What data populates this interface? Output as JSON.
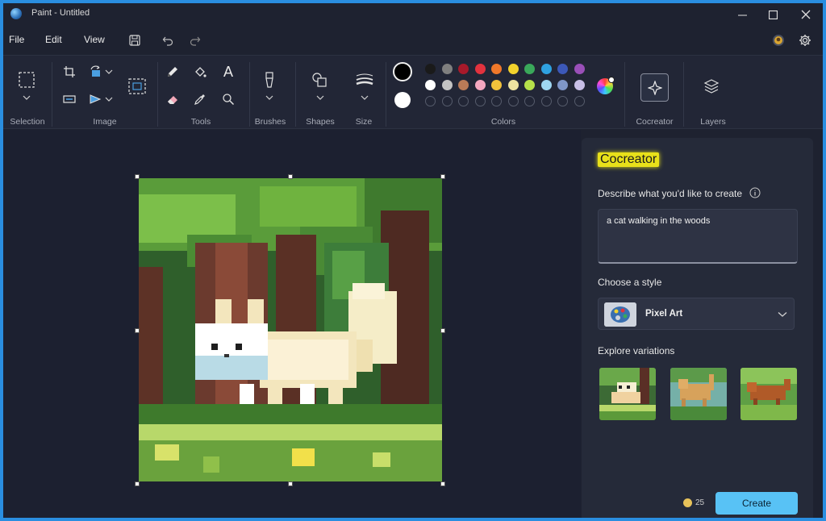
{
  "window": {
    "title": "Paint - Untitled"
  },
  "menubar": {
    "items": [
      "File",
      "Edit",
      "View"
    ]
  },
  "ribbon": {
    "groups": {
      "selection": "Selection",
      "image": "Image",
      "tools": "Tools",
      "brushes": "Brushes",
      "shapes": "Shapes",
      "size": "Size",
      "colors": "Colors",
      "cocreator": "Cocreator",
      "layers": "Layers"
    },
    "text_tool": "A",
    "primary_color": "#000000",
    "secondary_color": "#ffffff",
    "palette_row1": [
      "#1a1a1a",
      "#7f7f7f",
      "#a8192a",
      "#e2323e",
      "#f0782a",
      "#f2d22c",
      "#3aa85a",
      "#2fa1e0",
      "#3c58b8",
      "#9a4fb8"
    ],
    "palette_row2": [
      "#ffffff",
      "#c3c3c3",
      "#b97a57",
      "#f4a7c0",
      "#f2c23b",
      "#ece2a0",
      "#b5e04a",
      "#9fd7f2",
      "#7f96c8",
      "#c8bfe7"
    ]
  },
  "cocreator_panel": {
    "title": "Cocreator",
    "describe_label": "Describe what you'd like to create",
    "prompt_text": "a cat walking in the woods",
    "style_label": "Choose a style",
    "style_value": "Pixel Art",
    "variations_label": "Explore variations",
    "credits": "25",
    "create_label": "Create"
  },
  "icons": {
    "info": "info-icon",
    "chevron": "chevron-down-icon",
    "coin": "coin-icon"
  }
}
